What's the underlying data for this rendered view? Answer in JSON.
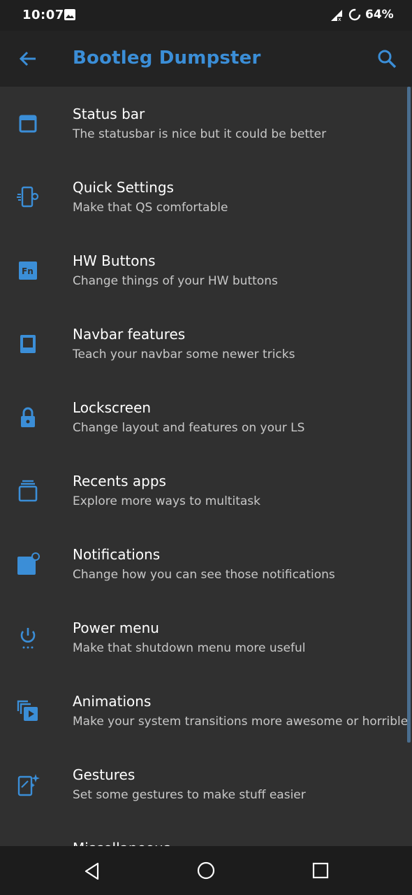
{
  "status_bar": {
    "time": "10:07",
    "battery": "64%",
    "icons": [
      "image-icon",
      "signal-icon",
      "battery-saver-icon"
    ]
  },
  "app_bar": {
    "title": "Bootleg Dumpster",
    "accent_color": "#3b8ed7",
    "back_icon": "arrow-back-icon",
    "search_icon": "search-icon"
  },
  "items": [
    {
      "title": "Status bar",
      "summary": "The statusbar is nice but it could be better",
      "icon": "status-bar-icon"
    },
    {
      "title": "Quick Settings",
      "summary": "Make that QS comfortable",
      "icon": "phone-settings-icon"
    },
    {
      "title": "HW Buttons",
      "summary": "Change things of your HW buttons",
      "icon": "fn-key-icon"
    },
    {
      "title": "Navbar features",
      "summary": "Teach your navbar some newer tricks",
      "icon": "navbar-icon"
    },
    {
      "title": "Lockscreen",
      "summary": "Change layout and features on your LS",
      "icon": "lock-icon"
    },
    {
      "title": "Recents apps",
      "summary": "Explore more ways to multitask",
      "icon": "recents-icon"
    },
    {
      "title": "Notifications",
      "summary": "Change how you can see those notifications",
      "icon": "notification-icon"
    },
    {
      "title": "Power menu",
      "summary": "Make that shutdown menu more useful",
      "icon": "power-icon"
    },
    {
      "title": "Animations",
      "summary": "Make your system transitions more awesome or horrible",
      "icon": "animation-icon"
    },
    {
      "title": "Gestures",
      "summary": "Set some gestures to make stuff easier",
      "icon": "gesture-icon"
    },
    {
      "title": "Miscellaneous",
      "summary": "",
      "icon": "misc-icon"
    }
  ],
  "nav_bar": {
    "icons": [
      "nav-back-icon",
      "nav-home-icon",
      "nav-recents-icon"
    ]
  }
}
